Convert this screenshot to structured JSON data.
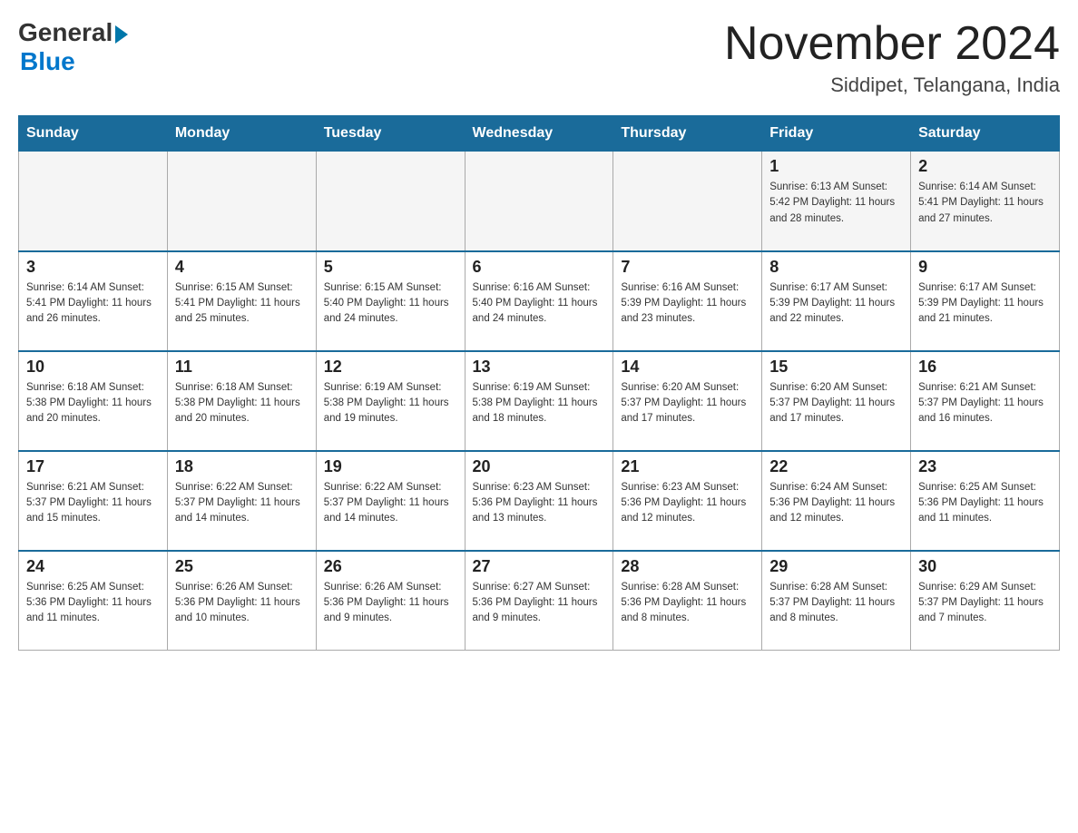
{
  "header": {
    "logo_general": "General",
    "logo_blue": "Blue",
    "month_title": "November 2024",
    "location": "Siddipet, Telangana, India"
  },
  "days_of_week": [
    "Sunday",
    "Monday",
    "Tuesday",
    "Wednesday",
    "Thursday",
    "Friday",
    "Saturday"
  ],
  "weeks": [
    [
      {
        "day": "",
        "info": ""
      },
      {
        "day": "",
        "info": ""
      },
      {
        "day": "",
        "info": ""
      },
      {
        "day": "",
        "info": ""
      },
      {
        "day": "",
        "info": ""
      },
      {
        "day": "1",
        "info": "Sunrise: 6:13 AM\nSunset: 5:42 PM\nDaylight: 11 hours\nand 28 minutes."
      },
      {
        "day": "2",
        "info": "Sunrise: 6:14 AM\nSunset: 5:41 PM\nDaylight: 11 hours\nand 27 minutes."
      }
    ],
    [
      {
        "day": "3",
        "info": "Sunrise: 6:14 AM\nSunset: 5:41 PM\nDaylight: 11 hours\nand 26 minutes."
      },
      {
        "day": "4",
        "info": "Sunrise: 6:15 AM\nSunset: 5:41 PM\nDaylight: 11 hours\nand 25 minutes."
      },
      {
        "day": "5",
        "info": "Sunrise: 6:15 AM\nSunset: 5:40 PM\nDaylight: 11 hours\nand 24 minutes."
      },
      {
        "day": "6",
        "info": "Sunrise: 6:16 AM\nSunset: 5:40 PM\nDaylight: 11 hours\nand 24 minutes."
      },
      {
        "day": "7",
        "info": "Sunrise: 6:16 AM\nSunset: 5:39 PM\nDaylight: 11 hours\nand 23 minutes."
      },
      {
        "day": "8",
        "info": "Sunrise: 6:17 AM\nSunset: 5:39 PM\nDaylight: 11 hours\nand 22 minutes."
      },
      {
        "day": "9",
        "info": "Sunrise: 6:17 AM\nSunset: 5:39 PM\nDaylight: 11 hours\nand 21 minutes."
      }
    ],
    [
      {
        "day": "10",
        "info": "Sunrise: 6:18 AM\nSunset: 5:38 PM\nDaylight: 11 hours\nand 20 minutes."
      },
      {
        "day": "11",
        "info": "Sunrise: 6:18 AM\nSunset: 5:38 PM\nDaylight: 11 hours\nand 20 minutes."
      },
      {
        "day": "12",
        "info": "Sunrise: 6:19 AM\nSunset: 5:38 PM\nDaylight: 11 hours\nand 19 minutes."
      },
      {
        "day": "13",
        "info": "Sunrise: 6:19 AM\nSunset: 5:38 PM\nDaylight: 11 hours\nand 18 minutes."
      },
      {
        "day": "14",
        "info": "Sunrise: 6:20 AM\nSunset: 5:37 PM\nDaylight: 11 hours\nand 17 minutes."
      },
      {
        "day": "15",
        "info": "Sunrise: 6:20 AM\nSunset: 5:37 PM\nDaylight: 11 hours\nand 17 minutes."
      },
      {
        "day": "16",
        "info": "Sunrise: 6:21 AM\nSunset: 5:37 PM\nDaylight: 11 hours\nand 16 minutes."
      }
    ],
    [
      {
        "day": "17",
        "info": "Sunrise: 6:21 AM\nSunset: 5:37 PM\nDaylight: 11 hours\nand 15 minutes."
      },
      {
        "day": "18",
        "info": "Sunrise: 6:22 AM\nSunset: 5:37 PM\nDaylight: 11 hours\nand 14 minutes."
      },
      {
        "day": "19",
        "info": "Sunrise: 6:22 AM\nSunset: 5:37 PM\nDaylight: 11 hours\nand 14 minutes."
      },
      {
        "day": "20",
        "info": "Sunrise: 6:23 AM\nSunset: 5:36 PM\nDaylight: 11 hours\nand 13 minutes."
      },
      {
        "day": "21",
        "info": "Sunrise: 6:23 AM\nSunset: 5:36 PM\nDaylight: 11 hours\nand 12 minutes."
      },
      {
        "day": "22",
        "info": "Sunrise: 6:24 AM\nSunset: 5:36 PM\nDaylight: 11 hours\nand 12 minutes."
      },
      {
        "day": "23",
        "info": "Sunrise: 6:25 AM\nSunset: 5:36 PM\nDaylight: 11 hours\nand 11 minutes."
      }
    ],
    [
      {
        "day": "24",
        "info": "Sunrise: 6:25 AM\nSunset: 5:36 PM\nDaylight: 11 hours\nand 11 minutes."
      },
      {
        "day": "25",
        "info": "Sunrise: 6:26 AM\nSunset: 5:36 PM\nDaylight: 11 hours\nand 10 minutes."
      },
      {
        "day": "26",
        "info": "Sunrise: 6:26 AM\nSunset: 5:36 PM\nDaylight: 11 hours\nand 9 minutes."
      },
      {
        "day": "27",
        "info": "Sunrise: 6:27 AM\nSunset: 5:36 PM\nDaylight: 11 hours\nand 9 minutes."
      },
      {
        "day": "28",
        "info": "Sunrise: 6:28 AM\nSunset: 5:36 PM\nDaylight: 11 hours\nand 8 minutes."
      },
      {
        "day": "29",
        "info": "Sunrise: 6:28 AM\nSunset: 5:37 PM\nDaylight: 11 hours\nand 8 minutes."
      },
      {
        "day": "30",
        "info": "Sunrise: 6:29 AM\nSunset: 5:37 PM\nDaylight: 11 hours\nand 7 minutes."
      }
    ]
  ]
}
